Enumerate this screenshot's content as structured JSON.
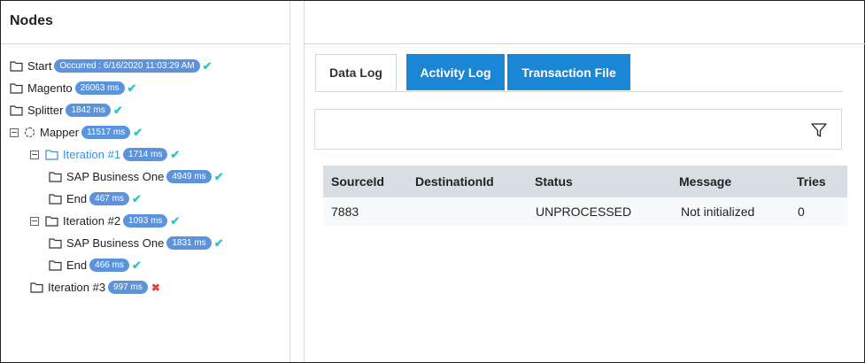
{
  "nodes_panel": {
    "title": "Nodes",
    "tree": [
      {
        "label": "Start",
        "badge": "Occurred : 6/16/2020 11:03:29 AM",
        "status": "✔"
      },
      {
        "label": "Magento",
        "badge": "26063 ms",
        "status": "✔"
      },
      {
        "label": "Splitter",
        "badge": "1842 ms",
        "status": "✔"
      },
      {
        "label": "Mapper",
        "badge": "11517 ms",
        "status": "✔"
      },
      {
        "label": "Iteration #1",
        "badge": "1714 ms",
        "status": "✔"
      },
      {
        "label": "SAP Business One",
        "badge": "4949 ms",
        "status": "✔"
      },
      {
        "label": "End",
        "badge": "467 ms",
        "status": "✔"
      },
      {
        "label": "Iteration #2",
        "badge": "1093 ms",
        "status": "✔"
      },
      {
        "label": "SAP Business One",
        "badge": "1831 ms",
        "status": "✔"
      },
      {
        "label": "End",
        "badge": "466 ms",
        "status": "✔"
      },
      {
        "label": "Iteration #3",
        "badge": "997 ms",
        "status": "✖"
      }
    ]
  },
  "tabs": [
    {
      "label": "Data Log"
    },
    {
      "label": "Activity Log"
    },
    {
      "label": "Transaction File"
    }
  ],
  "grid": {
    "columns": [
      "SourceId",
      "DestinationId",
      "Status",
      "Message",
      "Tries"
    ],
    "rows": [
      [
        "7883",
        "",
        "UNPROCESSED",
        "Not initialized",
        "0"
      ]
    ]
  },
  "colors": {
    "badge": "#5b93dc",
    "check": "#2fc6c6",
    "error": "#e0474c",
    "tab_blue": "#1a86d6",
    "active_node": "#3c8ee0"
  },
  "icons": {
    "folder": "folder-icon",
    "filter": "filter-icon",
    "collapse": "minus-box-icon",
    "loading": "dashed-circle-icon"
  }
}
